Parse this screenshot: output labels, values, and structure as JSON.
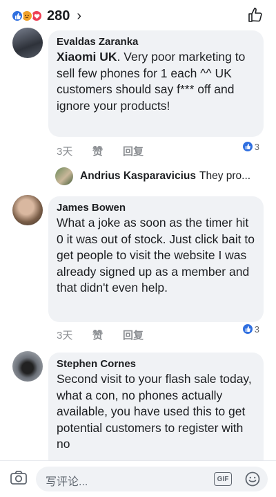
{
  "header": {
    "reaction_count": "280",
    "chevron": "›"
  },
  "comments": [
    {
      "author": "Evaldas Zaranka",
      "mention": "Xiaomi UK",
      "text": ". Very poor marketing to sell few phones for 1 each ^^ UK customers should say f*** off and ignore your products!",
      "time": "3天",
      "like_label": "赞",
      "reply_label": "回复",
      "reactions": "3"
    },
    {
      "author": "James Bowen",
      "text": "What a joke as soon as the timer hit  0 it was out of stock. Just click bait to get people to visit the website I was already signed up as a member and that didn't even help.",
      "time": "3天",
      "like_label": "赞",
      "reply_label": "回复",
      "reactions": "3"
    },
    {
      "author": "Stephen Cornes",
      "text": "Second visit to your flash sale today, what a con, no phones actually available, you have used this to get potential customers to register with no"
    }
  ],
  "reply_preview": {
    "name": "Andrius Kasparavicius",
    "snippet": "They pro..."
  },
  "composer": {
    "placeholder": "写评论...",
    "gif_label": "GIF"
  },
  "colors": {
    "like_blue": "#2f6fe0",
    "bubble": "#f0f2f5",
    "meta_gray": "#8a8d91"
  },
  "icons": [
    "like-reaction-icon",
    "angry-reaction-icon",
    "love-reaction-icon",
    "thumbs-up-icon",
    "camera-icon",
    "gif-icon",
    "emoji-icon"
  ]
}
